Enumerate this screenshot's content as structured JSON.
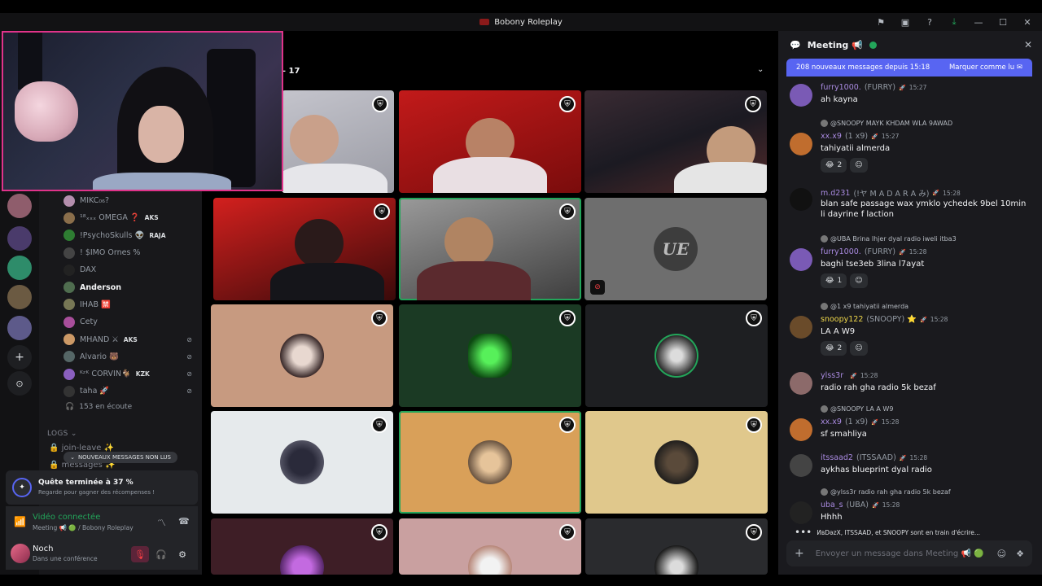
{
  "window": {
    "title": "Bobony Roleplay"
  },
  "stage": {
    "count_label": "– 17"
  },
  "members": [
    {
      "name": "MIKC₀₆?",
      "tag": "",
      "color": "#b48ead"
    },
    {
      "name": "¹⁸ₓₓₓ OMEGA ❓",
      "tag": "AKS",
      "color": "#8a6e4b"
    },
    {
      "name": "!PsychoSkulls 👽",
      "tag": "RAJA",
      "color": "#2e7d32"
    },
    {
      "name": "! $IMO Ornes %",
      "tag": "",
      "color": "#444"
    },
    {
      "name": "DAX",
      "tag": "",
      "color": "#222"
    },
    {
      "name": "Anderson",
      "tag": "",
      "color": "#4f6d4f",
      "bright": true
    },
    {
      "name": "IHAB 🈲",
      "tag": "",
      "color": "#775"
    },
    {
      "name": "Cety",
      "tag": "",
      "color": "#a84e9b"
    },
    {
      "name": "MHAND ⚔",
      "tag": "AKS",
      "color": "#c96"
    },
    {
      "name": "Alvario 🐻",
      "tag": "",
      "color": "#566"
    },
    {
      "name": "ᴷᶻᴷ CORVIN🐐",
      "tag": "KZK",
      "color": "#8a5fbf"
    },
    {
      "name": "taha 🚀",
      "tag": "",
      "color": "#333"
    }
  ],
  "listening": "153 en écoute",
  "logs": {
    "header": "LOGS ⌄",
    "channels": [
      "join-leave ✨",
      "messages ✨"
    ]
  },
  "unread_pill": "NOUVEAUX MESSAGES NON LUS",
  "quest": {
    "title": "Quête terminée à 37 %",
    "subtitle": "Regarde pour gagner des récompenses !"
  },
  "voice": {
    "title": "Vidéo connectée",
    "subtitle": "Meeting 📢 🟢 / Bobony Roleplay"
  },
  "user": {
    "name": "Noch",
    "status": "Dans une conférence"
  },
  "chat": {
    "channel": "Meeting 📢",
    "banner_left": "208 nouveaux messages depuis 15:18",
    "banner_right": "Marquer comme lu",
    "messages": [
      {
        "reply": "",
        "user": "furry1000.",
        "handle": "(FURRY)",
        "time": "15:27",
        "text": "ah kayna",
        "react": "",
        "react_count": "",
        "name_color": "#a98ae0",
        "av": "#7a5ab5"
      },
      {
        "reply": "@SNOOPY MAYK KHDAM WLA 9AWAD",
        "user": "xx.x9",
        "handle": "(1 x9)",
        "time": "15:27",
        "text": "tahiyatii almerda",
        "react": "😂",
        "react_count": "2",
        "name_color": "#a98ae0",
        "av": "#c06d2e"
      },
      {
        "reply": "",
        "user": "m.d231",
        "handle": "(!ヤ M A D A R A み)",
        "time": "15:28",
        "text": "blan safe passage wax ymklo ychedek 9bel 10min li dayrine f laction",
        "react": "",
        "react_count": "",
        "name_color": "#a98ae0",
        "av": "#111"
      },
      {
        "reply": "@UBA Brina lhjer dyal radio iweli itba3",
        "user": "furry1000.",
        "handle": "(FURRY)",
        "time": "15:28",
        "text": "baghi tse3eb 3lina l7ayat",
        "react": "😂",
        "react_count": "1",
        "name_color": "#a98ae0",
        "av": "#7a5ab5"
      },
      {
        "reply": "@1 x9 tahiyatii almerda",
        "user": "snoopy122",
        "handle": "(SNOOPY) ⭐",
        "time": "15:28",
        "text": "LA A W9",
        "react": "😂",
        "react_count": "2",
        "name_color": "#f0d84a",
        "av": "#6a4b2a"
      },
      {
        "reply": "",
        "user": "ylss3r",
        "handle": "",
        "time": "15:28",
        "text": "radio rah gha radio 5k bezaf",
        "react": "",
        "react_count": "",
        "name_color": "#a98ae0",
        "av": "#8c6a6a"
      },
      {
        "reply": "@SNOOPY LA A W9",
        "user": "xx.x9",
        "handle": "(1 x9)",
        "time": "15:28",
        "text": "sf smahliya",
        "react": "",
        "react_count": "",
        "name_color": "#a98ae0",
        "av": "#c06d2e"
      },
      {
        "reply": "",
        "user": "itssaad2",
        "handle": "(ITSSAAD)",
        "time": "15:28",
        "text": "aykhas blueprint dyal radio",
        "react": "",
        "react_count": "",
        "name_color": "#a98ae0",
        "av": "#444"
      },
      {
        "reply": "@ylss3r radio rah gha radio 5k bezaf",
        "user": "uba_s",
        "handle": "(UBA)",
        "time": "15:28",
        "text": "Hhhh",
        "react": "",
        "react_count": "",
        "name_color": "#a98ae0",
        "av": "#222"
      }
    ],
    "typing": "ИвDəzX, ITSSAAD, et SNOOPY sont en train d'écrire...",
    "composer_placeholder": "Envoyer un message dans Meeting 📢 🟢"
  },
  "colors": {
    "accent": "#5865f2",
    "online": "#23a55a",
    "live": "#e0338a"
  }
}
